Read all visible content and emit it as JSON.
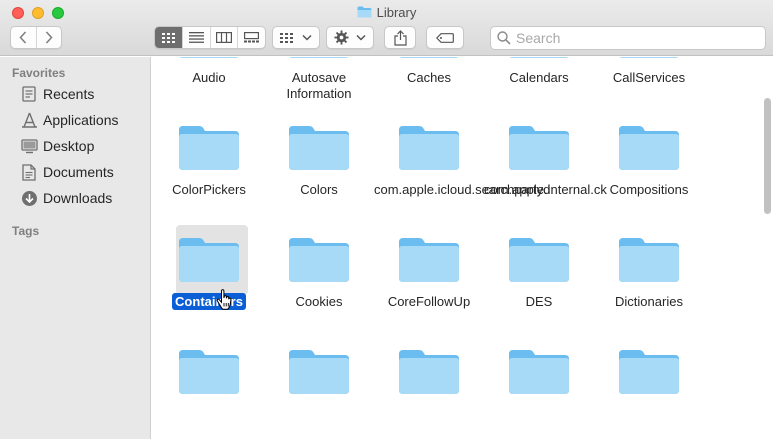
{
  "window": {
    "title": "Library"
  },
  "toolbar": {
    "back_icon": "chevron-left-icon",
    "forward_icon": "chevron-right-icon",
    "view_modes": [
      "icon-view",
      "list-view",
      "column-view",
      "gallery-view"
    ],
    "active_view": "icon-view",
    "search_placeholder": "Search"
  },
  "sidebar": {
    "favorites_heading": "Favorites",
    "tags_heading": "Tags",
    "items": [
      {
        "label": "Recents",
        "icon": "clock-icon"
      },
      {
        "label": "Applications",
        "icon": "applications-icon"
      },
      {
        "label": "Desktop",
        "icon": "desktop-icon"
      },
      {
        "label": "Documents",
        "icon": "document-icon"
      },
      {
        "label": "Downloads",
        "icon": "download-icon"
      }
    ]
  },
  "folders": [
    {
      "label": "Audio"
    },
    {
      "label": "Autosave Information"
    },
    {
      "label": "Caches"
    },
    {
      "label": "Calendars"
    },
    {
      "label": "CallServices"
    },
    {
      "label": "ColorPickers"
    },
    {
      "label": "Colors"
    },
    {
      "label": "com.apple.icloud.searchpartyd"
    },
    {
      "label": "com.apple.internal.ck"
    },
    {
      "label": "Compositions"
    },
    {
      "label": "Containers",
      "selected": true
    },
    {
      "label": "Cookies"
    },
    {
      "label": "CoreFollowUp"
    },
    {
      "label": "DES"
    },
    {
      "label": "Dictionaries"
    },
    {
      "label": ""
    },
    {
      "label": ""
    },
    {
      "label": ""
    },
    {
      "label": ""
    },
    {
      "label": ""
    }
  ],
  "colors": {
    "folder_light": "#a6daf7",
    "folder_dark": "#6bbdf0",
    "selection": "#0b5fd6"
  }
}
